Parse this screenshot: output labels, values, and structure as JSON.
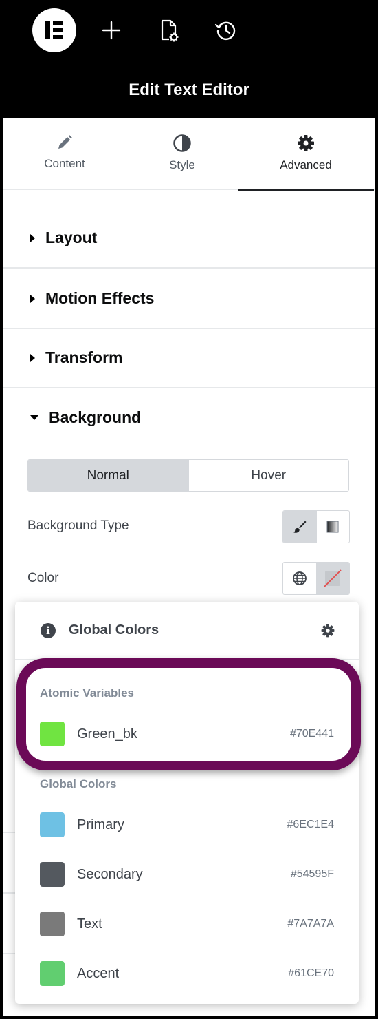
{
  "toolbar": {
    "logo_icon": "elementor-logo-icon",
    "add_icon": "plus-icon",
    "page_settings_icon": "page-settings-icon",
    "history_icon": "history-icon"
  },
  "header": {
    "title": "Edit Text Editor"
  },
  "tabs": [
    {
      "label": "Content",
      "icon": "pencil-icon"
    },
    {
      "label": "Style",
      "icon": "contrast-icon"
    },
    {
      "label": "Advanced",
      "icon": "gear-icon",
      "active": true
    }
  ],
  "sections": [
    {
      "title": "Layout",
      "expanded": false
    },
    {
      "title": "Motion Effects",
      "expanded": false
    },
    {
      "title": "Transform",
      "expanded": false
    },
    {
      "title": "Background",
      "expanded": true
    }
  ],
  "background": {
    "state_tabs": {
      "normal": "Normal",
      "hover": "Hover",
      "selected": "Normal"
    },
    "type_label": "Background Type",
    "color_label": "Color"
  },
  "global_colors_popover": {
    "title": "Global Colors",
    "atomic_group_title": "Atomic Variables",
    "atomic_variables": [
      {
        "name": "Green_bk",
        "hex": "#70E441"
      }
    ],
    "global_group_title": "Global Colors",
    "global_colors": [
      {
        "name": "Primary",
        "hex": "#6EC1E4"
      },
      {
        "name": "Secondary",
        "hex": "#54595F"
      },
      {
        "name": "Text",
        "hex": "#7A7A7A"
      },
      {
        "name": "Accent",
        "hex": "#61CE70"
      }
    ]
  },
  "colors": {
    "highlight": "#6b0a57",
    "panel_dark": "#000000"
  }
}
